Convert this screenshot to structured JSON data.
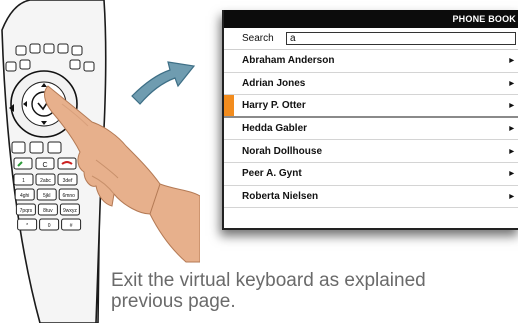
{
  "phonebook": {
    "title": "PHONE BOOK",
    "search_label": "Search",
    "search_value": "a",
    "contacts": [
      {
        "name": "Abraham Anderson"
      },
      {
        "name": "Adrian Jones"
      },
      {
        "name": "Harry P. Otter"
      },
      {
        "name": "Hedda Gabler"
      },
      {
        "name": "Norah Dollhouse"
      },
      {
        "name": "Peer A. Gynt"
      },
      {
        "name": "Roberta Nielsen"
      }
    ],
    "selected_index": 2,
    "row_icon": "chevron-right-icon"
  },
  "remote": {
    "keypad": [
      "1",
      "2abc",
      "3def",
      "4ghi",
      "5jkl",
      "6mno",
      "7pqrs",
      "8tuv",
      "9wxyz",
      "*",
      "0",
      "#"
    ],
    "clear_label": "C"
  },
  "caption": {
    "line1": "Exit the virtual keyboard as explained",
    "line2": "previous page."
  },
  "colors": {
    "highlight": "#f28c1e",
    "header_bg": "#0c0c0c",
    "arrow": "#6f9cb0",
    "skin": "#e7b08c"
  }
}
